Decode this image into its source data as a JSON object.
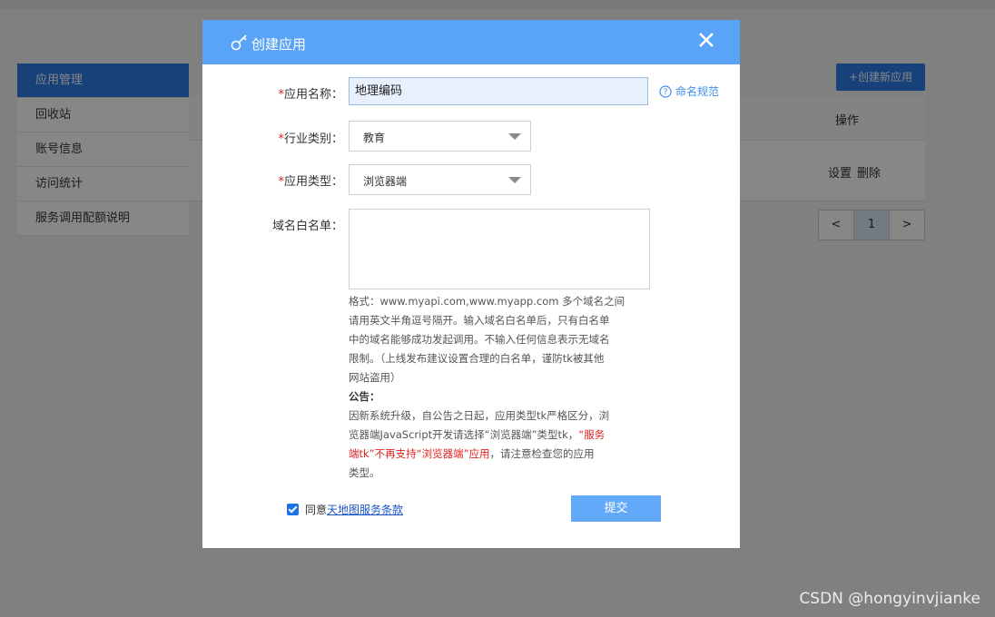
{
  "background": {
    "sidebar": {
      "items": [
        {
          "label": "应用管理",
          "active": true
        },
        {
          "label": "回收站",
          "active": false
        },
        {
          "label": "账号信息",
          "active": false
        },
        {
          "label": "访问统计",
          "active": false
        },
        {
          "label": "服务调用配额说明",
          "active": false
        }
      ]
    },
    "create_button": "+创建新应用",
    "table": {
      "ops_header": "操作",
      "row_actions": [
        "设置",
        "删除"
      ]
    },
    "pagination": {
      "prev": "<",
      "current": "1",
      "next": ">"
    }
  },
  "modal": {
    "title": "创建应用",
    "icons": {
      "header": "key-icon",
      "close": "close-icon",
      "help": "question-circle-icon"
    },
    "fields": {
      "app_name": {
        "required_mark": "*",
        "label": "应用名称：",
        "value": "地理编码"
      },
      "industry": {
        "required_mark": "*",
        "label": "行业类别：",
        "selected": "教育"
      },
      "app_type": {
        "required_mark": "*",
        "label": "应用类型：",
        "selected": "浏览器端"
      },
      "whitelist": {
        "label": "域名白名单：",
        "value": ""
      }
    },
    "help_link": "命名规范",
    "hint_lines": [
      "格式：www.myapi.com,www.myapp.com 多个域名之间",
      "请用英文半角逗号隔开。输入域名白名单后，只有白名单",
      "中的域名能够成功发起调用。不输入任何信息表示无域名",
      "限制。（上线发布建议设置合理的白名单，谨防tk被其他",
      "网站盗用）"
    ],
    "notice_title": "公告：",
    "notice_line1": "因新系统升级，自公告之日起，应用类型tk严格区分，浏",
    "notice_line2": "览器端JavaScript开发请选择“浏览器端”类型tk，",
    "notice_red1": "“服务",
    "notice_red2": "端tk”不再支持“浏览器端”应用",
    "notice_after_red": "，请注意检查您的应用",
    "notice_line4": "类型。",
    "agree_text": "同意",
    "terms_link": "天地图服务条款",
    "agree_checked": true,
    "submit_label": "提交"
  },
  "watermark": "CSDN @hongyinvjianke",
  "colors": {
    "header": "#5aa4f8",
    "accent": "#2d7be5",
    "required": "#e02020",
    "link": "#3b8ff0"
  }
}
